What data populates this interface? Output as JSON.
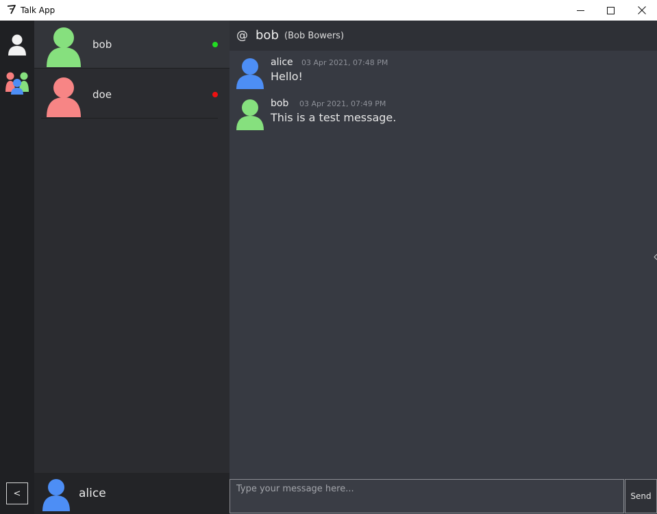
{
  "window": {
    "title": "Talk App"
  },
  "colors": {
    "rail_bg": "#1f2023",
    "contacts_bg": "#2b2c30",
    "chat_bg": "#373a42",
    "header_bg": "#2e3036",
    "avatar_bob": "#86e07e",
    "avatar_doe": "#f78585",
    "avatar_alice": "#4d8ef5",
    "status_online": "#22dd22",
    "status_offline": "#ee1111"
  },
  "rail": {
    "user_icon": "user-icon",
    "group_icon": "group-icon",
    "collapse_label": "<"
  },
  "contacts": [
    {
      "name": "bob",
      "status": "online",
      "avatar_color": "#86e07e"
    },
    {
      "name": "doe",
      "status": "offline",
      "avatar_color": "#f78585"
    }
  ],
  "self": {
    "name": "alice"
  },
  "chat": {
    "at_symbol": "@",
    "username": "bob",
    "full_name": "(Bob Bowers)",
    "messages": [
      {
        "author": "alice",
        "time": "03 Apr 2021, 07:48 PM",
        "text": "Hello!"
      },
      {
        "author": "bob",
        "time": "03 Apr 2021, 07:49 PM",
        "text": "This is a test message."
      }
    ],
    "input_placeholder": "Type your message here...",
    "send_label": "Send"
  }
}
